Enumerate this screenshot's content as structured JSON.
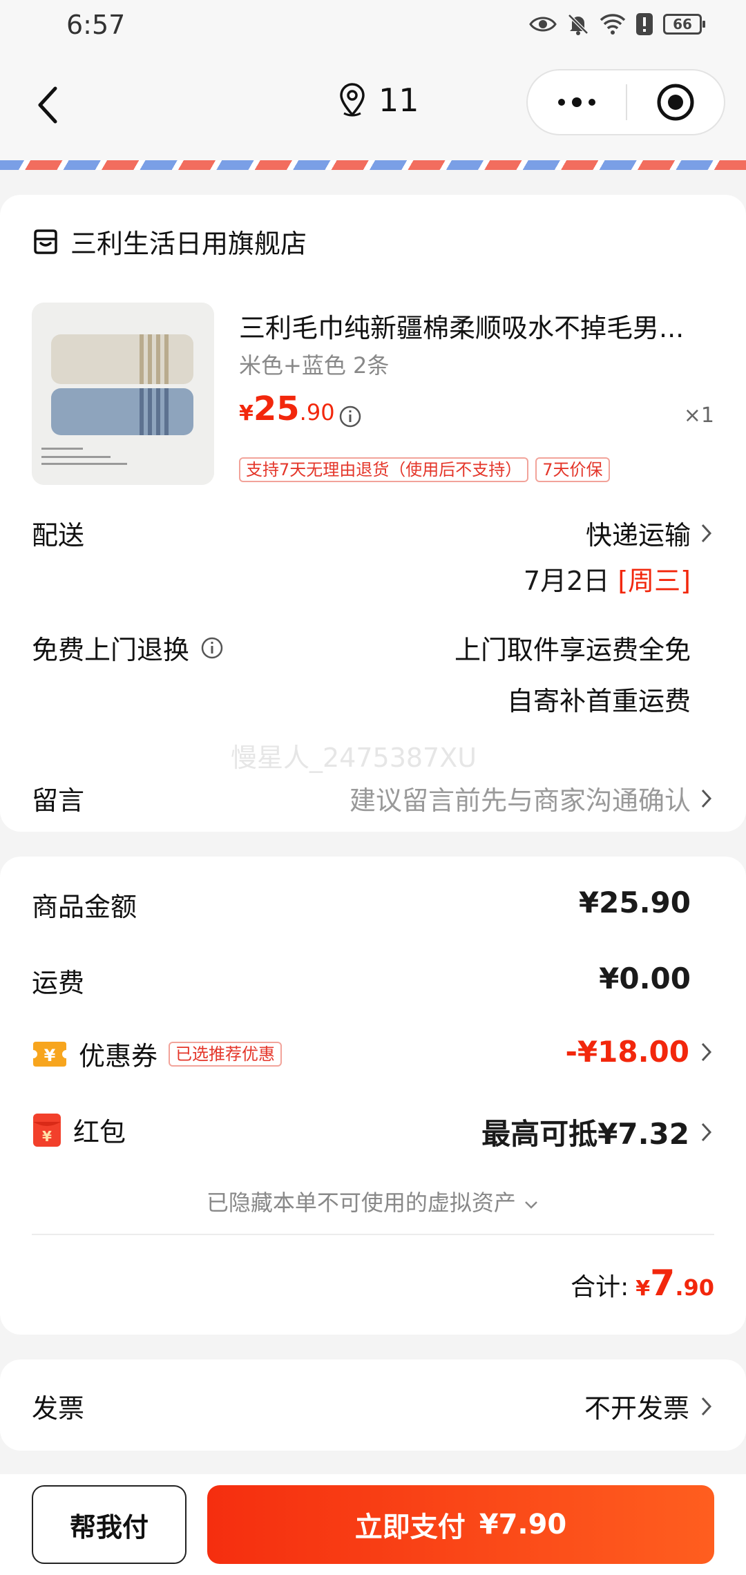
{
  "status_bar": {
    "time": "6:57",
    "battery": "66"
  },
  "nav": {
    "title": "11"
  },
  "shop": {
    "name": "三利生活日用旗舰店"
  },
  "product": {
    "title": "三利毛巾纯新疆棉柔顺吸水不掉毛男...",
    "variant": "米色+蓝色 2条",
    "price_symbol": "¥",
    "price_int": "25",
    "price_dec": ".90",
    "qty": "×1",
    "tags": [
      "支持7天无理由退货（使用后不支持）",
      "7天价保"
    ]
  },
  "delivery": {
    "label": "配送",
    "method": "快递运输",
    "date": "7月2日",
    "weekday": "[周三]"
  },
  "free_return": {
    "label": "免费上门退换",
    "line1": "上门取件享运费全免",
    "line2": "自寄补首重运费"
  },
  "watermark": "慢星人_2475387XU",
  "note": {
    "label": "留言",
    "placeholder": "建议留言前先与商家沟通确认"
  },
  "summary": {
    "goods_label": "商品金额",
    "goods_value": "¥25.90",
    "ship_label": "运费",
    "ship_value": "¥0.00",
    "coupon_label": "优惠券",
    "coupon_tag": "已选推荐优惠",
    "coupon_value": "-¥18.00",
    "hongbao_label": "红包",
    "hongbao_value": "最高可抵¥7.32",
    "hidden_assets": "已隐藏本单不可使用的虚拟资产",
    "total_label": "合计:",
    "total_symbol": "¥",
    "total_int": "7",
    "total_dec": ".90"
  },
  "invoice": {
    "label": "发票",
    "value": "不开发票"
  },
  "actions": {
    "help_pay": "帮我付",
    "pay_now": "立即支付",
    "pay_amount": "¥7.90"
  },
  "colors": {
    "accent": "#f2270c",
    "stripe_red": "#f26d5e",
    "stripe_blue": "#7a9fe6",
    "coupon_icon": "#f7a51e"
  }
}
